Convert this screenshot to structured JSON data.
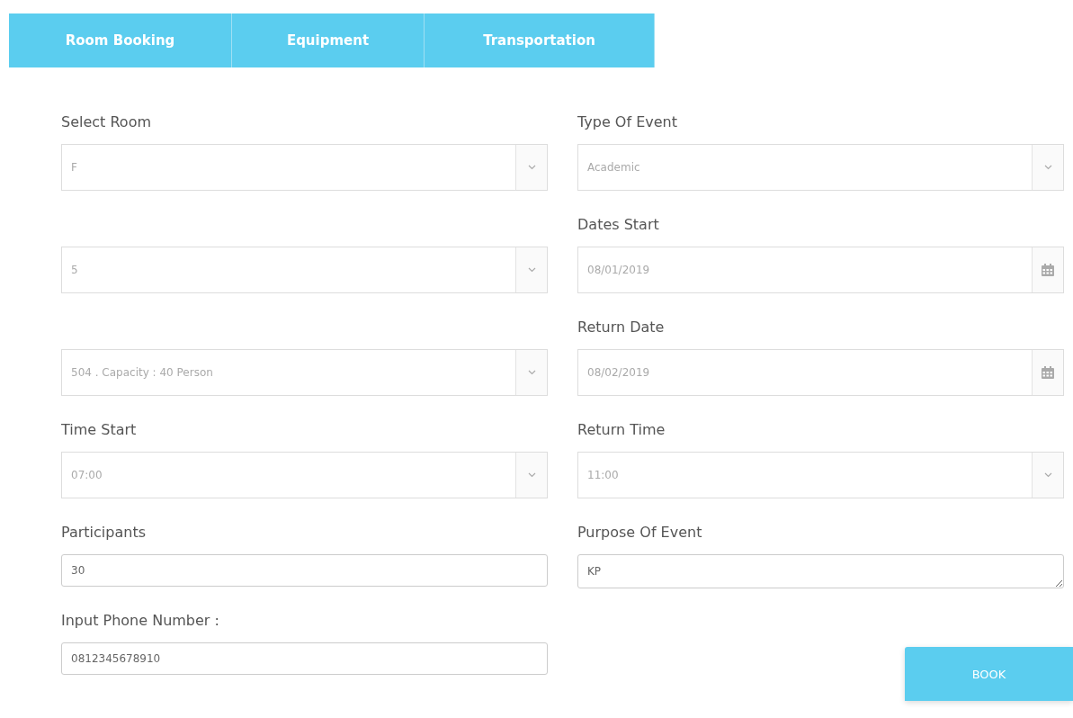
{
  "tabs": [
    {
      "label": "Room Booking"
    },
    {
      "label": "Equipment"
    },
    {
      "label": "Transportation"
    }
  ],
  "columns": [
    {
      "fields": [
        {
          "label": "Select Room",
          "kind": "select",
          "value": "F"
        },
        {
          "kind": "select",
          "value": "5"
        },
        {
          "kind": "select",
          "value": "504 . Capacity : 40 Person"
        },
        {
          "label": "Time Start",
          "kind": "select",
          "value": "07:00"
        },
        {
          "label": "Participants",
          "kind": "text",
          "value": "30"
        },
        {
          "label": "Input Phone Number :",
          "kind": "text",
          "value": "0812345678910"
        }
      ]
    },
    {
      "fields": [
        {
          "label": "Type Of Event",
          "kind": "select",
          "value": "Academic"
        },
        {
          "label": "Dates Start",
          "kind": "date",
          "value": "08/01/2019"
        },
        {
          "label": "Return Date",
          "kind": "date",
          "value": "08/02/2019"
        },
        {
          "label": "Return Time",
          "kind": "select",
          "value": "11:00"
        },
        {
          "label": "Purpose Of Event",
          "kind": "textarea",
          "value": "KP"
        }
      ]
    }
  ],
  "book_button": {
    "label": "BOOK"
  }
}
